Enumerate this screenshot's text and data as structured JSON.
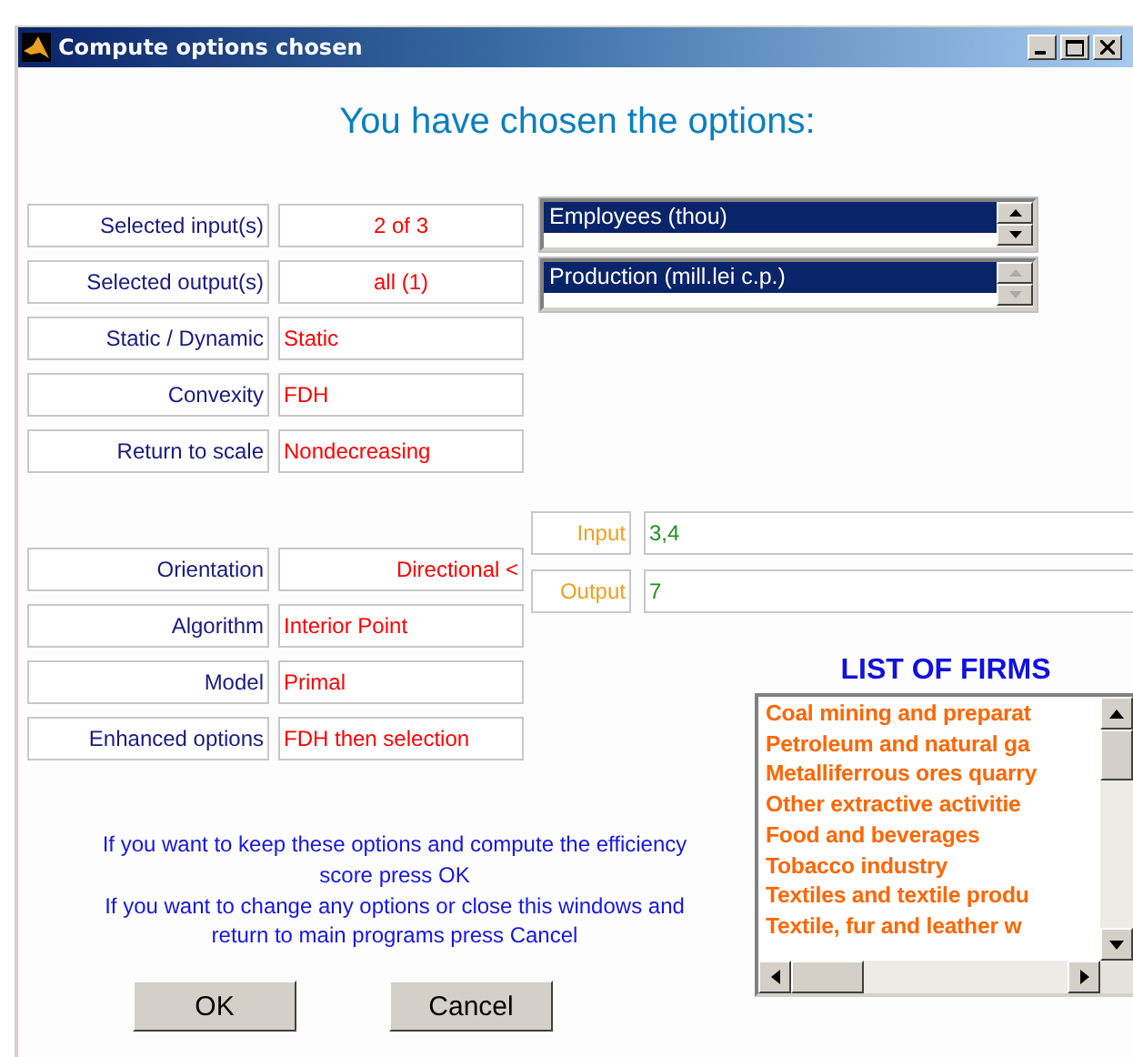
{
  "window": {
    "title": "Compute options chosen"
  },
  "heading": "You have chosen the options:",
  "options": [
    {
      "label": "Selected input(s)",
      "value": "2 of 3"
    },
    {
      "label": "Selected output(s)",
      "value": "all (1)"
    },
    {
      "label": "Static / Dynamic",
      "value": "Static"
    },
    {
      "label": "Convexity",
      "value": "FDH"
    },
    {
      "label": "Return to scale",
      "value": "Nondecreasing"
    }
  ],
  "input_list": {
    "items": [
      {
        "label": "Employees (thou)",
        "selected": true
      }
    ]
  },
  "output_list": {
    "items": [
      {
        "label": "Production (mill.lei c.p.)",
        "selected": true
      }
    ]
  },
  "method": [
    {
      "label": "Orientation",
      "value": "Directional <"
    },
    {
      "label": "Algorithm",
      "value": "Interior Point"
    },
    {
      "label": "Model",
      "value": "Primal"
    },
    {
      "label": "Enhanced options",
      "value": "FDH then selection"
    }
  ],
  "direction": [
    {
      "label": "Input",
      "value": "3,4"
    },
    {
      "label": "Output",
      "value": "7"
    }
  ],
  "firms": {
    "title": "LIST OF FIRMS",
    "items": [
      "Coal mining and preparat",
      "Petroleum and natural ga",
      "Metalliferrous ores quarry",
      "Other extractive activitie",
      "Food and beverages",
      "Tobacco industry",
      "Textiles and textile produ",
      "Textile, fur and leather w"
    ]
  },
  "message": [
    "If you want to keep these options and compute the efficiency score press OK",
    "If you want to change any options or close this windows and return to main programs press Cancel"
  ],
  "buttons": [
    "OK",
    "Cancel"
  ]
}
